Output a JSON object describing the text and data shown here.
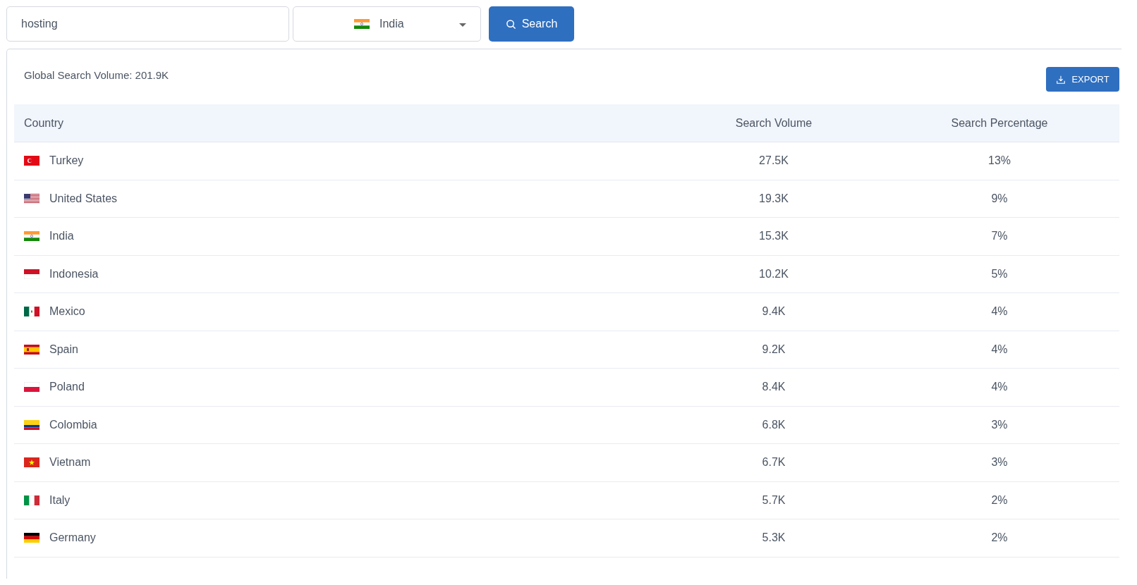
{
  "search": {
    "value": "hosting",
    "button": "Search"
  },
  "country_select": {
    "value": "India",
    "kind": "in"
  },
  "summary": "Global Search Volume: 201.9K",
  "export_button": "EXPORT",
  "table": {
    "columns": [
      "Country",
      "Search Volume",
      "Search Percentage"
    ],
    "rows": [
      {
        "kind": "tr",
        "country": "Turkey",
        "volume": "27.5K",
        "percentage": "13%"
      },
      {
        "kind": "us",
        "country": "United States",
        "volume": "19.3K",
        "percentage": "9%"
      },
      {
        "kind": "in",
        "country": "India",
        "volume": "15.3K",
        "percentage": "7%"
      },
      {
        "kind": "id",
        "country": "Indonesia",
        "volume": "10.2K",
        "percentage": "5%"
      },
      {
        "kind": "mx",
        "country": "Mexico",
        "volume": "9.4K",
        "percentage": "4%"
      },
      {
        "kind": "es",
        "country": "Spain",
        "volume": "9.2K",
        "percentage": "4%"
      },
      {
        "kind": "pl",
        "country": "Poland",
        "volume": "8.4K",
        "percentage": "4%"
      },
      {
        "kind": "co",
        "country": "Colombia",
        "volume": "6.8K",
        "percentage": "3%"
      },
      {
        "kind": "vn",
        "country": "Vietnam",
        "volume": "6.7K",
        "percentage": "3%"
      },
      {
        "kind": "it",
        "country": "Italy",
        "volume": "5.7K",
        "percentage": "2%"
      },
      {
        "kind": "de",
        "country": "Germany",
        "volume": "5.3K",
        "percentage": "2%"
      }
    ]
  }
}
